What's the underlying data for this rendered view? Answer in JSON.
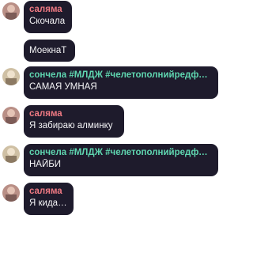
{
  "messages": [
    {
      "author": "саляма",
      "author_color": "#f07a83",
      "text": "Скочала"
    },
    {
      "author": "",
      "text": "МоекнаТ"
    },
    {
      "author": "сончела #МЛДЖ #челетополнийредфла...",
      "author_color": "#5fd6b0",
      "text": "САМАЯ УМНАЯ"
    },
    {
      "author": "саляма",
      "author_color": "#f07a83",
      "text": "Я забираю алминку"
    },
    {
      "author": "сончела #МЛДЖ #челетополнийредфла...",
      "author_color": "#5fd6b0",
      "text": "НАЙБИ"
    },
    {
      "author": "саляма",
      "author_color": "#f07a83",
      "text": "Я кидала"
    }
  ],
  "colors": {
    "bubble": "#1e1b2c",
    "message_text": "#f4f4f6",
    "background": "#ffffff"
  }
}
